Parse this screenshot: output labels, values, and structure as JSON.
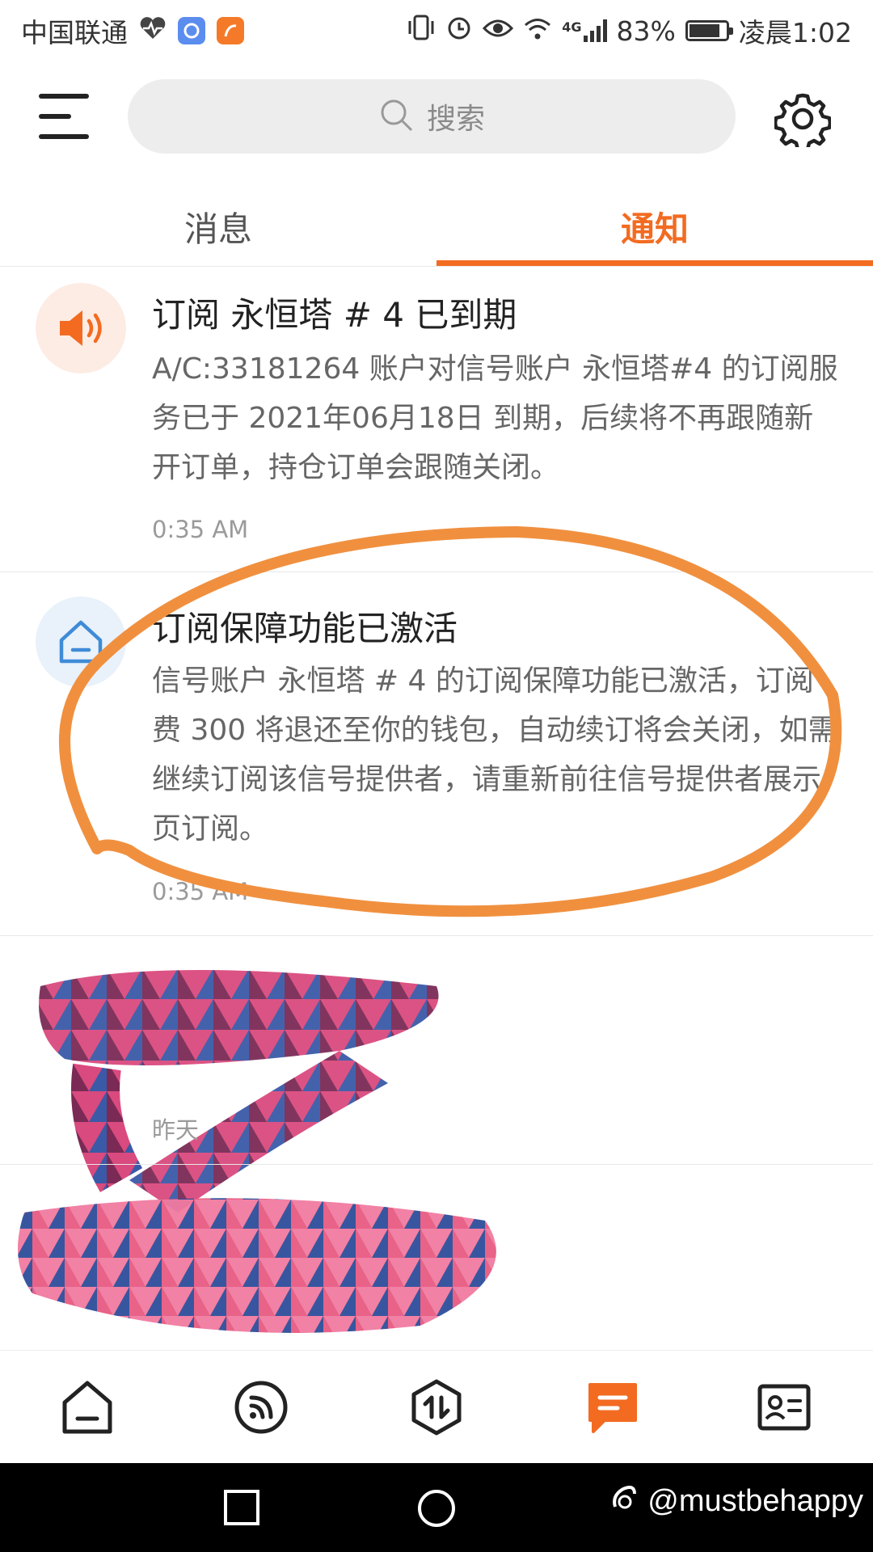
{
  "status_bar": {
    "carrier": "中国联通",
    "network": "4G",
    "battery": "83%",
    "battery_level": 0.83,
    "time": "凌晨1:02"
  },
  "header": {
    "search_placeholder": "搜索"
  },
  "tabs": [
    {
      "label": "消息",
      "active": false
    },
    {
      "label": "通知",
      "active": true
    }
  ],
  "notifications": [
    {
      "icon": "speaker-icon",
      "title": "订阅 永恒塔 # 4 已到期",
      "body": "A/C:33181264 账户对信号账户 永恒塔#4 的订阅服务已于 2021年06月18日 到期，后续将不再跟随新开订单，持仓订单会跟随关闭。",
      "time": "0:35 AM"
    },
    {
      "icon": "shield-home-icon",
      "title": "订阅保障功能已激活",
      "body": "信号账户 永恒塔 # 4 的订阅保障功能已激活，订阅费 300 将退还至你的钱包，自动续订将会关闭，如需继续订阅该信号提供者，请重新前往信号提供者展示页订阅。",
      "time": "0:35 AM"
    },
    {
      "icon": "obscured-icon",
      "title": "",
      "body": "",
      "time": "昨天"
    }
  ],
  "bottom_nav": [
    "home-icon",
    "feed-icon",
    "trade-icon",
    "messages-icon",
    "profile-card-icon"
  ],
  "colors": {
    "accent": "#f26b21",
    "annotation": "#f0903f"
  },
  "watermark": "@mustbehappy"
}
